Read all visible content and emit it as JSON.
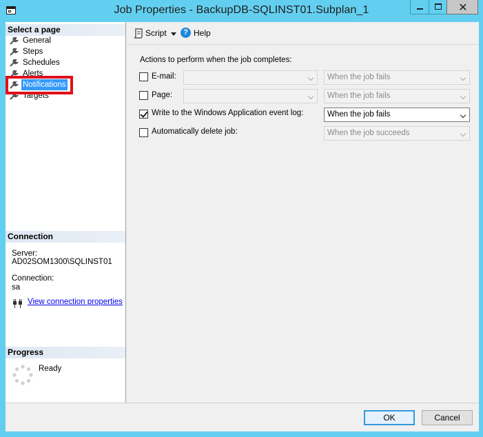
{
  "window": {
    "title": "Job Properties - BackupDB-SQLINST01.Subplan_1",
    "close_glyph": "✕"
  },
  "left_pane": {
    "select_page_header": "Select a page",
    "pages": [
      {
        "label": "General",
        "icon": "wrench-icon"
      },
      {
        "label": "Steps",
        "icon": "wrench-icon"
      },
      {
        "label": "Schedules",
        "icon": "wrench-icon"
      },
      {
        "label": "Alerts",
        "icon": "wrench-icon"
      },
      {
        "label": "Notifications",
        "icon": "wrench-icon",
        "selected": true
      },
      {
        "label": "Targets",
        "icon": "wrench-icon"
      }
    ],
    "connection": {
      "header": "Connection",
      "server_label": "Server:",
      "server_value": "AD02SOM1300\\SQLINST01",
      "connection_label": "Connection:",
      "connection_value": "sa",
      "link_label": "View connection properties"
    },
    "progress": {
      "header": "Progress",
      "status": "Ready"
    }
  },
  "toolbar": {
    "script_label": "Script",
    "help_label": "Help"
  },
  "notifications": {
    "intro": "Actions to perform when the job completes:",
    "rows": [
      {
        "label": "E-mail:",
        "checked": false,
        "recipient": "",
        "condition": "When the job fails",
        "enabled": false
      },
      {
        "label": "Page:",
        "checked": false,
        "recipient": "",
        "condition": "When the job fails",
        "enabled": false
      },
      {
        "label": "Write to the Windows Application event log:",
        "checked": true,
        "condition": "When the job fails",
        "enabled": true
      },
      {
        "label": "Automatically delete job:",
        "checked": false,
        "condition": "When the job succeeds",
        "enabled": false
      }
    ]
  },
  "buttons": {
    "ok": "OK",
    "cancel": "Cancel"
  },
  "colors": {
    "titlebar": "#63cff0",
    "selection": "#3399ff",
    "highlight_box": "#e0101a"
  }
}
